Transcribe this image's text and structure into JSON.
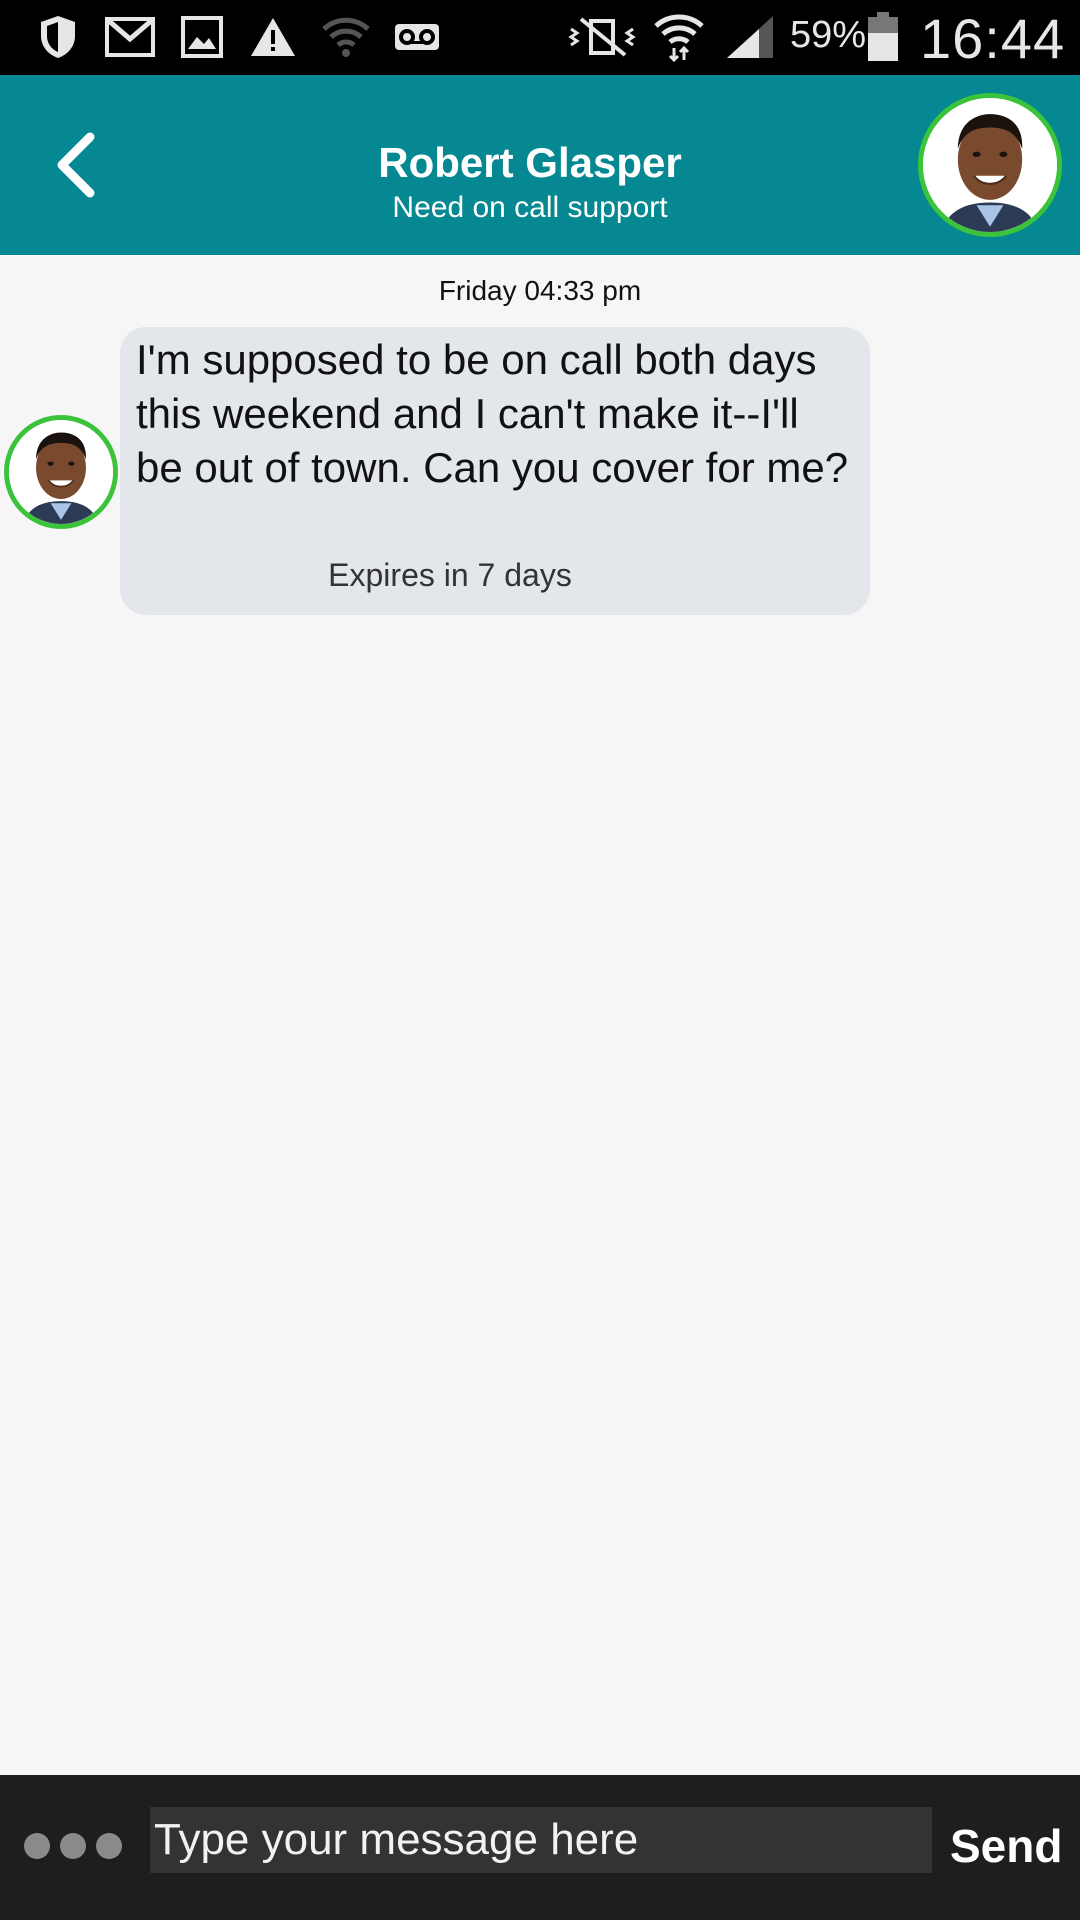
{
  "status_bar": {
    "battery_percent": "59%",
    "time": "16:44",
    "icons": [
      "shield-icon",
      "gmail-icon",
      "image-icon",
      "warning-icon",
      "wifi-outline-icon",
      "voicemail-icon",
      "vibrate-mute-icon",
      "wifi-data-icon",
      "signal-icon",
      "battery-icon"
    ]
  },
  "header": {
    "back_icon": "chevron-left-icon",
    "contact_name": "Robert Glasper",
    "subtitle": "Need on call support",
    "accent_color": "#058891",
    "avatar_ring_color": "#3bc43b"
  },
  "conversation": {
    "timestamp": "Friday 04:33 pm",
    "messages": [
      {
        "text": "I'm supposed to be on call both days this weekend and I can't make it--I'll be out of town. Can you cover for me?",
        "expiry": "Expires in 7 days"
      }
    ]
  },
  "composer": {
    "more_icon": "more-dots-icon",
    "placeholder": "Type your message here",
    "value": "",
    "send_label": "Send"
  }
}
